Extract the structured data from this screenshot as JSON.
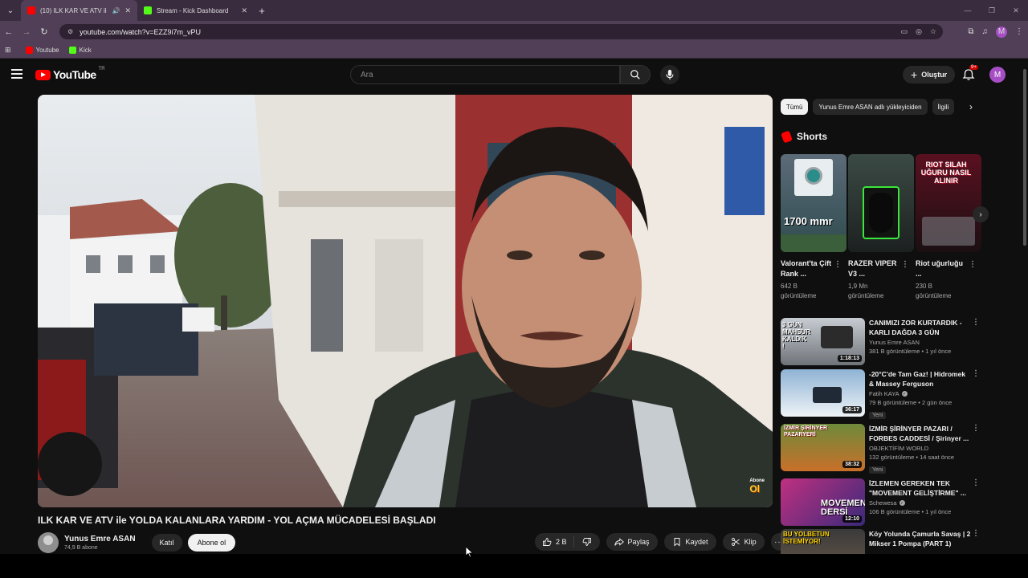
{
  "browser": {
    "tabs": [
      {
        "title": "(10) ILK KAR VE ATV ile YOLDA KALANLARA YARDIM",
        "active": true,
        "fav_color": "#ff0000"
      },
      {
        "title": "Stream - Kick Dashboard",
        "active": false,
        "fav_color": "#53fc18"
      }
    ],
    "url": "youtube.com/watch?v=EZZ9i7m_vPU",
    "profile_initial": "M",
    "bookmarks": [
      {
        "label": "Youtube",
        "color": "#ff0000"
      },
      {
        "label": "Kick",
        "color": "#53fc18"
      }
    ]
  },
  "header": {
    "logo_text": "YouTube",
    "country": "TR",
    "search_placeholder": "Ara",
    "create_label": "Oluştur",
    "notifications_badge": "9+",
    "avatar_initial": "M"
  },
  "video": {
    "title": "ILK KAR VE ATV ile YOLDA KALANLARA YARDIM - YOL AÇMA MÜCADELESİ BAŞLADI",
    "watermark_small": "Abone",
    "watermark_big": "Ol",
    "channel_name": "Yunus Emre ASAN",
    "subscribers": "74,9 B abone",
    "join_label": "Katıl",
    "subscribe_label": "Abone ol",
    "likes": "2 B",
    "share_label": "Paylaş",
    "save_label": "Kaydet",
    "clip_label": "Klip"
  },
  "sidebar": {
    "chips": [
      "Tümü",
      "Yunus Emre ASAN adlı yükleyiciden",
      "İlgili"
    ],
    "shorts_title": "Shorts",
    "shorts": [
      {
        "title": "Valorant'ta Çift Rank ...",
        "views": "642 B görüntüleme",
        "overlay": "1700 mmr"
      },
      {
        "title": "RAZER VIPER V3 ...",
        "views": "1,9 Mn görüntüleme",
        "overlay": ""
      },
      {
        "title": "Riot uğurluğu ...",
        "views": "230 B görüntüleme",
        "overlay": "RIOT SILAH UĞURU NASIL ALINIR"
      }
    ],
    "recommendations": [
      {
        "title": "CANIMIZI ZOR KURTARDIK - KARLI DAĞDA 3 GÜN MAHSU...",
        "channel": "Yunus Emre ASAN",
        "verified": false,
        "meta": "381 B görüntüleme • 1 yıl önce",
        "duration": "1:18:13",
        "new": false,
        "thumb_text": "3 GÜN MAHSUR KALDIK !"
      },
      {
        "title": "-20°C'de Tam Gaz! | Hidromek & Massey Ferguson",
        "channel": "Fatih KAYA",
        "verified": true,
        "meta": "79 B görüntüleme • 2 gün önce",
        "duration": "36:17",
        "new": true,
        "thumb_text": ""
      },
      {
        "title": "İZMİR ŞİRİNYER PAZARI / FORBES CADDESİ / Şirinyer ...",
        "channel": "OBJEKTİFİM WORLD",
        "verified": false,
        "meta": "132 görüntüleme • 14 saat önce",
        "duration": "38:32",
        "new": true,
        "thumb_text": "İZMİR ŞİRİNYER PAZARYERİ"
      },
      {
        "title": "İZLEMEN GEREKEN TEK \"MOVEMENT GELİŞTİRME\" ...",
        "channel": "Schewesa",
        "verified": true,
        "meta": "106 B görüntüleme • 1 yıl önce",
        "duration": "12:10",
        "new": false,
        "thumb_text": "MOVEMENT DERSİ"
      },
      {
        "title": "Köy Yolunda Çamurla Savaş | 2 Mikser 1 Pompa (PART 1)",
        "channel": "",
        "verified": false,
        "meta": "",
        "duration": "",
        "new": false,
        "thumb_text": "BU YOLBETUN İSTEMİYOR!"
      }
    ],
    "new_label": "Yeni"
  }
}
